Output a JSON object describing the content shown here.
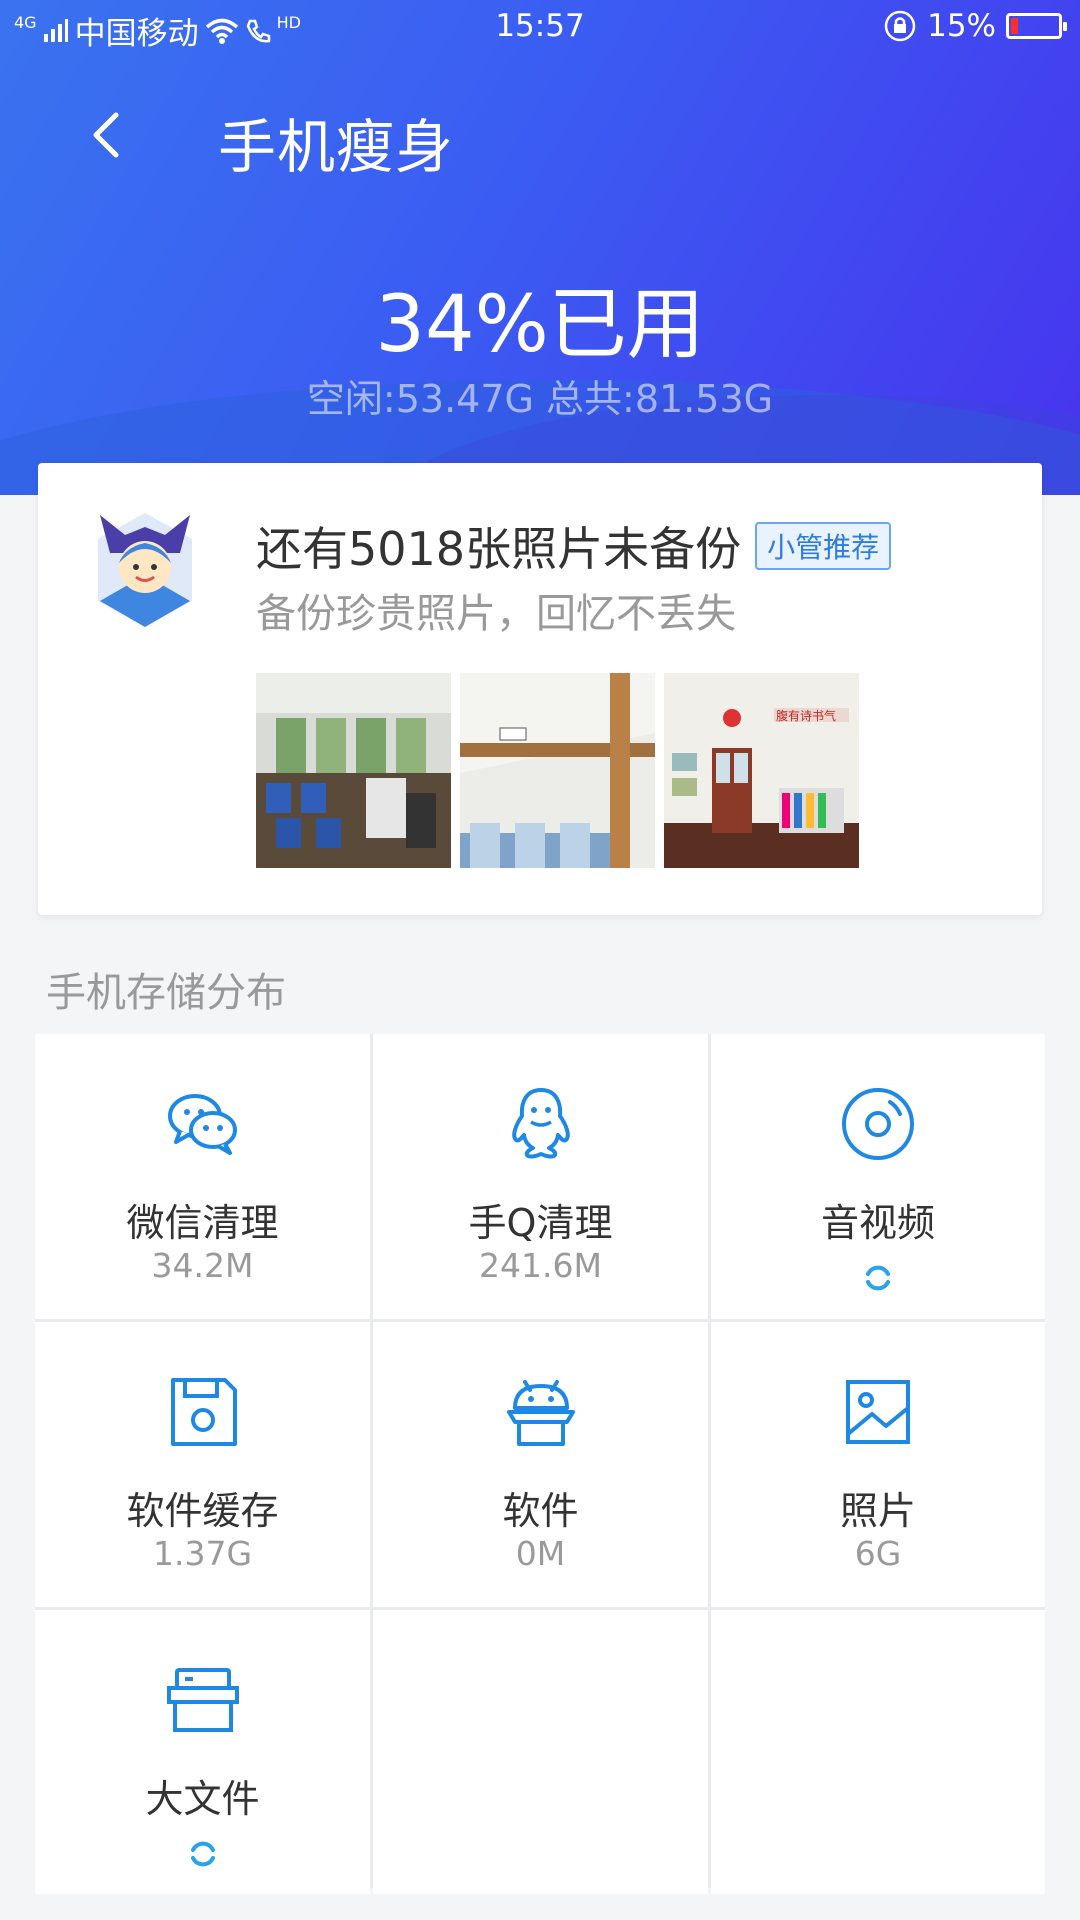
{
  "status_bar": {
    "network": "4G",
    "carrier": "中国移动",
    "hd": "HD",
    "time": "15:57",
    "battery_percent": "15%",
    "battery_level": 0.15
  },
  "header": {
    "title": "手机瘦身",
    "usage": "34%已用",
    "storage_summary": "空闲:53.47G 总共:81.53G"
  },
  "backup_card": {
    "title": "还有5018张照片未备份",
    "badge": "小管推荐",
    "subtitle": "备份珍贵照片，回忆不丢失"
  },
  "storage": {
    "section_title": "手机存储分布",
    "items": [
      {
        "label": "微信清理",
        "value": "34.2M",
        "icon": "wechat-icon"
      },
      {
        "label": "手Q清理",
        "value": "241.6M",
        "icon": "qq-icon"
      },
      {
        "label": "音视频",
        "value": "",
        "icon": "media-disc-icon"
      },
      {
        "label": "软件缓存",
        "value": "1.37G",
        "icon": "save-icon"
      },
      {
        "label": "软件",
        "value": "0M",
        "icon": "android-icon"
      },
      {
        "label": "照片",
        "value": "6G",
        "icon": "image-icon"
      },
      {
        "label": "大文件",
        "value": "",
        "icon": "box-icon"
      }
    ]
  },
  "colors": {
    "accent": "#1e88e5",
    "header_start": "#3a73f0",
    "header_end": "#4734ee"
  }
}
